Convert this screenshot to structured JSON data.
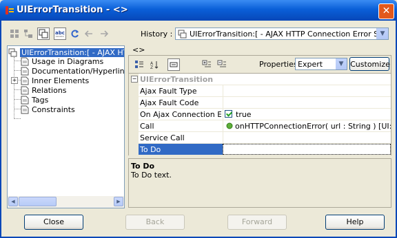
{
  "window": {
    "title": "UIErrorTransition - <>",
    "close_glyph": "✕"
  },
  "toolbar": {
    "history_label": "History :",
    "history_value": "UIErrorTransition:[ - AJAX HTTP Connection Error State] [..."
  },
  "tree": {
    "items": [
      {
        "label": "UIErrorTransition:[ - AJAX HTT"
      },
      {
        "label": "Usage in Diagrams"
      },
      {
        "label": "Documentation/Hyperlinks"
      },
      {
        "label": "Inner Elements"
      },
      {
        "label": "Relations"
      },
      {
        "label": "Tags"
      },
      {
        "label": "Constraints"
      }
    ]
  },
  "properties": {
    "tab_label": "<>",
    "props_label": "Properties:",
    "props_selected": "Expert",
    "customize_label": "Customize",
    "category": "UIErrorTransition",
    "rows": [
      {
        "name": "Ajax Fault Type",
        "value": ""
      },
      {
        "name": "Ajax Fault Code",
        "value": ""
      },
      {
        "name": "On Ajax Connection Er...",
        "value": "true"
      },
      {
        "name": "Call",
        "value": "onHTTPConnectionError( url : String ) [UI::N..."
      },
      {
        "name": "Service Call",
        "value": ""
      },
      {
        "name": "To Do",
        "value": ""
      }
    ]
  },
  "description": {
    "title": "To Do",
    "text": "To Do text."
  },
  "buttons": {
    "close": "Close",
    "back": "Back",
    "forward": "Forward",
    "help": "Help"
  }
}
